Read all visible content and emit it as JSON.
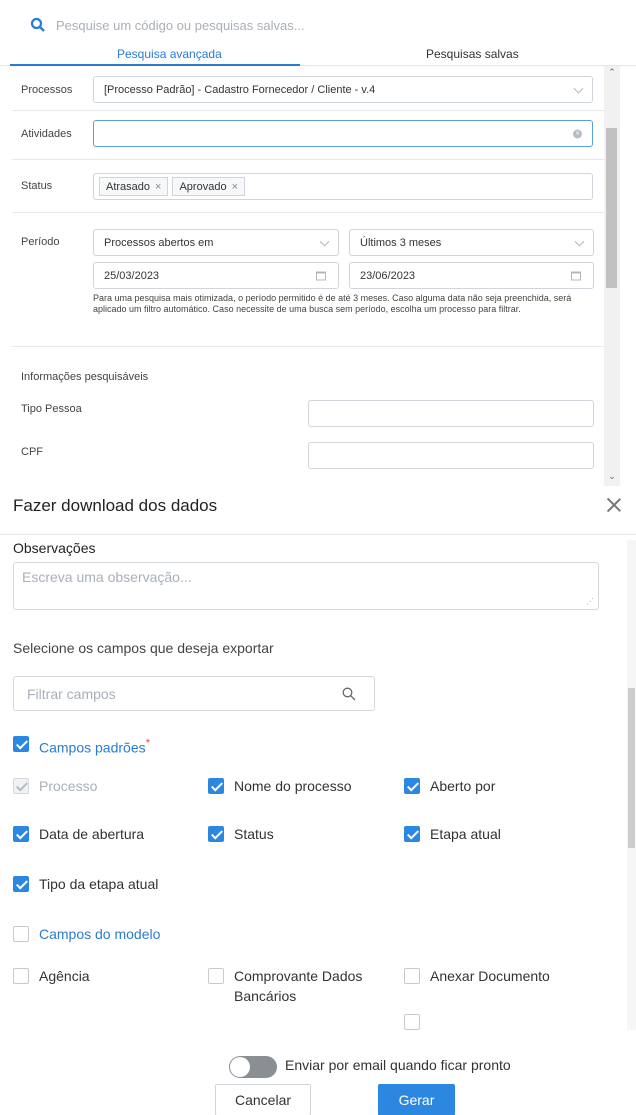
{
  "search": {
    "placeholder": "Pesquise um código ou pesquisas salvas..."
  },
  "tabs": [
    {
      "label": "Pesquisa avançada",
      "active": true
    },
    {
      "label": "Pesquisas salvas",
      "active": false
    }
  ],
  "form": {
    "processos": {
      "label": "Processos",
      "value": "[Processo Padrão] - Cadastro Fornecedor / Cliente - v.4"
    },
    "atividades": {
      "label": "Atividades",
      "value": ""
    },
    "status": {
      "label": "Status",
      "tags": [
        "Atrasado",
        "Aprovado"
      ]
    },
    "periodo": {
      "label": "Período",
      "type_value": "Processos abertos em",
      "range_value": "Últimos 3 meses",
      "start_date": "25/03/2023",
      "end_date": "23/06/2023",
      "note": "Para uma pesquisa mais otimizada, o período permitido é de até 3 meses. Caso alguma data não seja preenchida, será aplicado um filtro automático. Caso necessite de uma busca sem período, escolha um processo para filtrar."
    },
    "info_title": "Informações pesquisáveis",
    "tipo_pessoa": {
      "label": "Tipo Pessoa",
      "value": ""
    },
    "cpf": {
      "label": "CPF",
      "value": ""
    }
  },
  "dialog": {
    "title": "Fazer download dos dados",
    "obs_label": "Observações",
    "obs_placeholder": "Escreva uma observação...",
    "select_label": "Selecione os campos que deseja exportar",
    "filter_placeholder": "Filtrar campos",
    "group_default": {
      "label": "Campos padrões",
      "required_mark": "*",
      "checked": true
    },
    "default_fields": [
      {
        "label": "Processo",
        "checked": true,
        "disabled": true
      },
      {
        "label": "Nome do processo",
        "checked": true
      },
      {
        "label": "Aberto por",
        "checked": true
      },
      {
        "label": "Data de abertura",
        "checked": true
      },
      {
        "label": "Status",
        "checked": true
      },
      {
        "label": "Etapa atual",
        "checked": true
      },
      {
        "label": "Tipo da etapa atual",
        "checked": true
      }
    ],
    "group_model": {
      "label": "Campos do modelo",
      "checked": false
    },
    "model_fields": [
      {
        "label": "Agência",
        "checked": false
      },
      {
        "label": "Comprovante Dados Bancários",
        "checked": false
      },
      {
        "label": "Anexar Documento",
        "checked": false
      }
    ],
    "email_toggle_label": "Enviar por email quando ficar pronto",
    "email_toggle_on": false,
    "cancel_label": "Cancelar",
    "generate_label": "Gerar"
  },
  "colors": {
    "accent": "#2b87e0",
    "link": "#2b7bd3"
  }
}
